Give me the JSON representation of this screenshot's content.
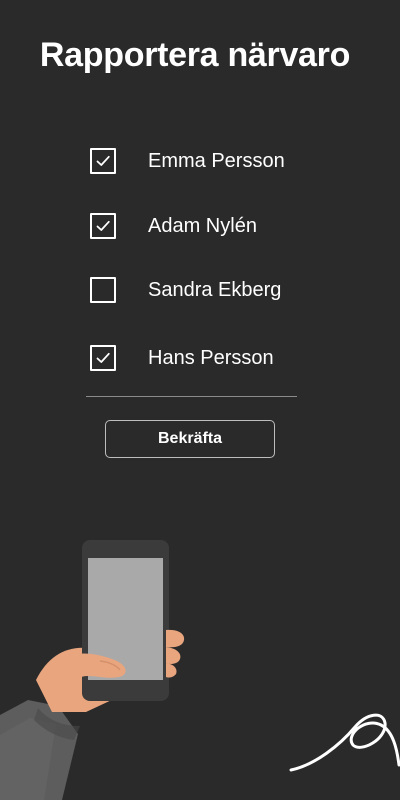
{
  "page": {
    "title": "Rapportera närvaro"
  },
  "attendance": {
    "students": [
      {
        "name": "Emma Persson",
        "checked": true
      },
      {
        "name": "Adam Nylén",
        "checked": true
      },
      {
        "name": "Sandra Ekberg",
        "checked": false
      },
      {
        "name": "Hans Persson",
        "checked": true
      }
    ]
  },
  "actions": {
    "confirm_label": "Bekräfta"
  },
  "illustration": {
    "icon": "hand-holding-phone-illustration",
    "accent_skin": "#e9a57e",
    "sleeve": "#5d5d5d",
    "phone_body": "#3b3b3b",
    "phone_screen": "#a9a9a9"
  },
  "colors": {
    "background": "#2a2a2a",
    "text": "#ffffff",
    "divider": "#8a8a8a",
    "button_border": "#bdbdbd"
  }
}
